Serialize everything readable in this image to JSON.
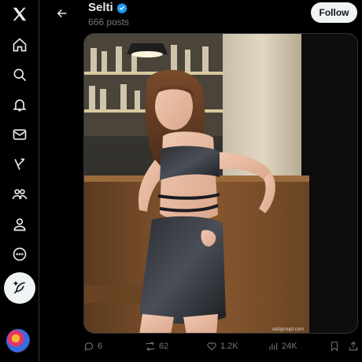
{
  "rail": {
    "items": [
      {
        "icon": "x-logo-icon"
      },
      {
        "icon": "home-icon"
      },
      {
        "icon": "search-icon"
      },
      {
        "icon": "bell-icon"
      },
      {
        "icon": "mail-icon"
      },
      {
        "icon": "grok-icon"
      },
      {
        "icon": "communities-icon"
      },
      {
        "icon": "profile-icon"
      },
      {
        "icon": "more-icon"
      }
    ],
    "post_button_icon": "feather-plus-icon"
  },
  "header": {
    "name": "Selti",
    "verified_icon": "verified-badge-icon",
    "verified_color": "#1d9bf0",
    "post_count": "666 posts",
    "follow_label": "Follow"
  },
  "media": {
    "watermark": "seltigroupt.com"
  },
  "actions": {
    "replies": "6",
    "reposts": "62",
    "likes": "1.2K",
    "views": "24K"
  }
}
